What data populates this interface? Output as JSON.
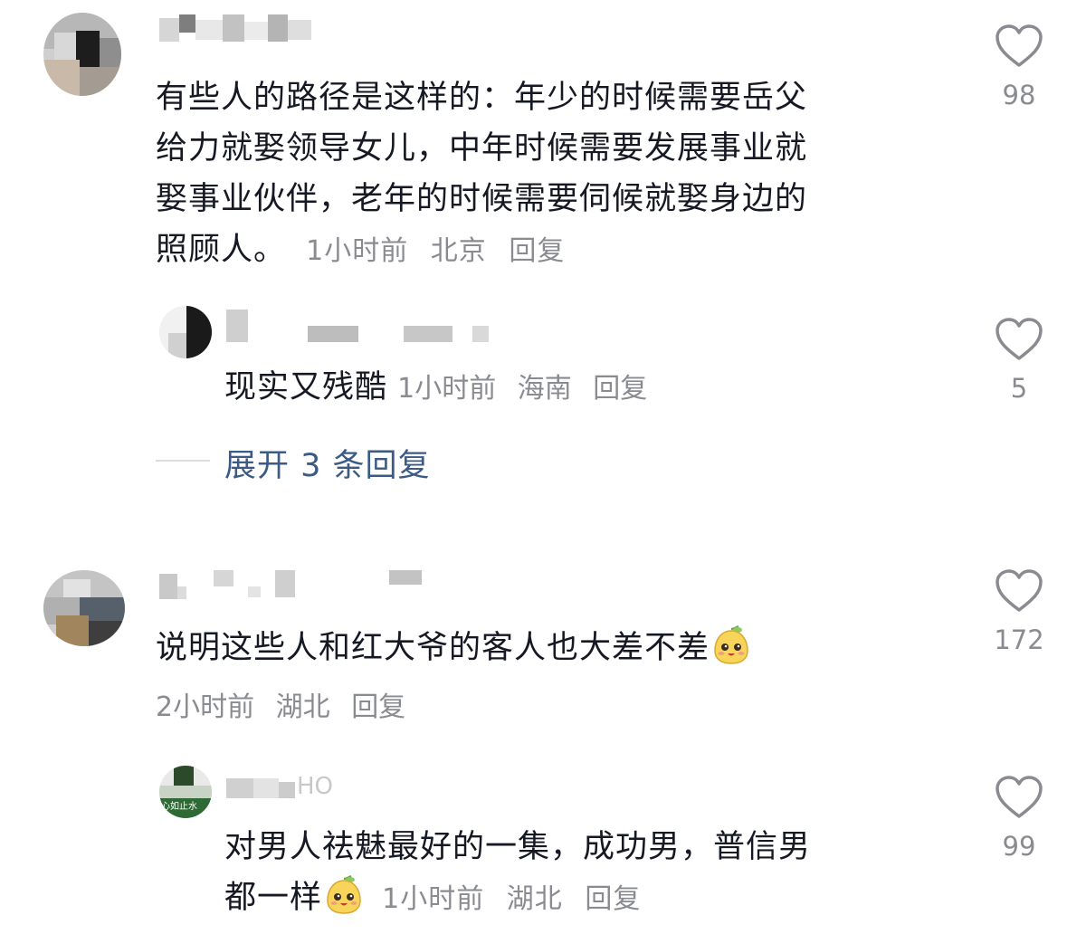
{
  "comments": [
    {
      "text_lines": [
        "有些人的路径是这样的：年少的时候需要岳父",
        "给力就娶领导女儿，中年时候需要发展事业就",
        "娶事业伙伴，老年的时候需要伺候就娶身边的",
        "照顾人。"
      ],
      "time": "1小时前",
      "location": "北京",
      "reply_label": "回复",
      "likes": "98",
      "icon": "heart-outline-icon",
      "replies": [
        {
          "text": "现实又残酷",
          "time": "1小时前",
          "location": "海南",
          "reply_label": "回复",
          "likes": "5"
        }
      ],
      "expand_label": "展开 3 条回复"
    },
    {
      "text": "说明这些人和红大爷的客人也大差不差",
      "emoji": "pear-face-emoji",
      "time": "2小时前",
      "location": "湖北",
      "reply_label": "回复",
      "likes": "172",
      "replies": [
        {
          "username_fragment": "HO",
          "avatar_text": "心如止水",
          "text_lines": [
            "对男人祛魅最好的一集，成功男，普信男",
            "都一样"
          ],
          "emoji": "pear-face-emoji",
          "time": "1小时前",
          "location": "湖北",
          "reply_label": "回复",
          "likes": "99"
        }
      ]
    }
  ],
  "colors": {
    "text": "#161823",
    "meta": "#8a8b91",
    "link": "#3b5b86",
    "heart": "#8a8b91"
  }
}
